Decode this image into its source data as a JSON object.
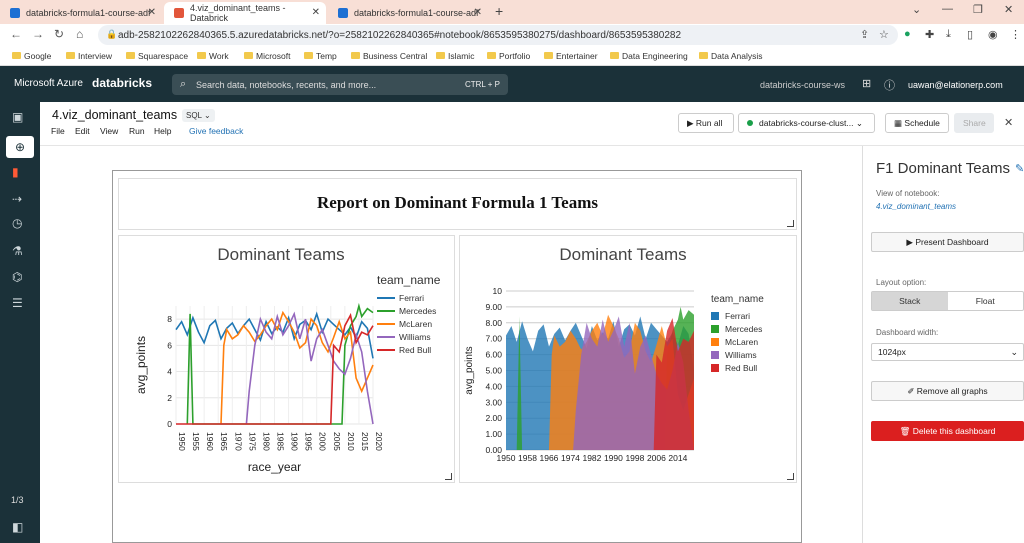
{
  "browser": {
    "tabs": [
      {
        "title": "databricks-formula1-course-adf",
        "favicon_color": "#1d6fd3"
      },
      {
        "title": "4.viz_dominant_teams - Databrick",
        "favicon_color": "#e2563b"
      },
      {
        "title": "databricks-formula1-course-adf",
        "favicon_color": "#1d6fd3"
      }
    ],
    "url": "adb-2582102262840365.5.azuredatabricks.net/?o=2582102262840365#notebook/8653595380275/dashboard/8653595380282",
    "bookmarks": [
      "Google",
      "Interview",
      "Squarespace",
      "Work",
      "Microsoft",
      "Temp",
      "Business Central",
      "Islamic",
      "Portfolio",
      "Entertainer",
      "Data Engineering",
      "Data Analysis"
    ]
  },
  "topbar": {
    "brand": "Microsoft Azure",
    "product": "databricks",
    "search_placeholder": "Search data, notebooks, recents, and more...",
    "search_shortcut": "CTRL + P",
    "workspace": "databricks-course-ws",
    "user": "uawan@elationerp.com"
  },
  "sidebar": {
    "page_indicator": "1/3"
  },
  "notebook": {
    "title": "4.viz_dominant_teams",
    "language": "SQL",
    "menu": [
      "File",
      "Edit",
      "View",
      "Run",
      "Help"
    ],
    "feedback": "Give feedback",
    "run_all": "Run all",
    "cluster": "databricks-course-clust...",
    "schedule": "Schedule",
    "share": "Share"
  },
  "dashboard": {
    "report_title": "Report on Dominant Formula 1 Teams",
    "colors": {
      "Ferrari": "#1f77b4",
      "Mercedes": "#2ca02c",
      "McLaren": "#ff7f0e",
      "Williams": "#9467bd",
      "Red Bull": "#d62728"
    }
  },
  "right_panel": {
    "title": "F1 Dominant Teams",
    "view_label": "View of notebook:",
    "notebook_link": "4.viz_dominant_teams",
    "present_button": "Present Dashboard",
    "layout_label": "Layout option:",
    "layout_stack": "Stack",
    "layout_float": "Float",
    "width_label": "Dashboard width:",
    "width_value": "1024px",
    "remove_button": "Remove all graphs",
    "delete_button": "Delete this dashboard"
  },
  "chart_data": [
    {
      "type": "line",
      "title": "Dominant Teams",
      "xlabel": "race_year",
      "ylabel": "avg_points",
      "legend_title": "team_name",
      "legend_position": "right",
      "xlim": [
        1950,
        2020
      ],
      "ylim": [
        0,
        9
      ],
      "x_ticks": [
        1950,
        1955,
        1960,
        1965,
        1970,
        1975,
        1980,
        1985,
        1990,
        1995,
        2000,
        2005,
        2010,
        2015,
        2020
      ],
      "y_ticks": [
        0,
        2,
        4,
        6,
        8
      ],
      "grid": true,
      "series": [
        {
          "name": "Ferrari",
          "x": [
            1950,
            1952,
            1954,
            1956,
            1958,
            1960,
            1962,
            1964,
            1966,
            1968,
            1970,
            1972,
            1974,
            1976,
            1978,
            1980,
            1982,
            1984,
            1986,
            1988,
            1990,
            1992,
            1994,
            1996,
            1998,
            2000,
            2002,
            2004,
            2006,
            2008,
            2010,
            2012,
            2014,
            2016,
            2018,
            2020
          ],
          "values": [
            7.2,
            7.8,
            6.8,
            8.1,
            7.0,
            6.2,
            7.5,
            7.9,
            6.5,
            7.3,
            7.7,
            6.9,
            7.5,
            8.0,
            7.2,
            6.4,
            7.8,
            6.9,
            7.4,
            7.0,
            8.1,
            6.5,
            7.6,
            7.9,
            7.2,
            8.4,
            7.0,
            8.0,
            7.6,
            7.2,
            6.8,
            7.4,
            6.6,
            7.8,
            7.3,
            5.0
          ]
        },
        {
          "name": "Mercedes",
          "x": [
            1954,
            1955,
            1956,
            2009,
            2010,
            2012,
            2014,
            2015,
            2016,
            2018,
            2020
          ],
          "values": [
            0,
            8.4,
            0,
            0,
            6.0,
            7.5,
            8.2,
            9.0,
            8.2,
            8.8,
            8.5
          ]
        },
        {
          "name": "McLaren",
          "x": [
            1966,
            1967,
            1968,
            1970,
            1972,
            1974,
            1976,
            1978,
            1980,
            1982,
            1984,
            1986,
            1988,
            1990,
            1992,
            1994,
            1996,
            1998,
            2000,
            2002,
            2004,
            2006,
            2008,
            2010,
            2012,
            2014,
            2016,
            2018,
            2020
          ],
          "values": [
            0,
            6.0,
            7.2,
            6.5,
            6.8,
            7.5,
            7.0,
            6.3,
            6.8,
            7.5,
            8.0,
            7.2,
            8.5,
            7.8,
            7.0,
            5.8,
            6.2,
            8.0,
            7.5,
            6.2,
            5.5,
            6.6,
            7.8,
            6.5,
            7.0,
            3.5,
            2.5,
            3.5,
            4.5
          ]
        },
        {
          "name": "Williams",
          "x": [
            1975,
            1976,
            1978,
            1980,
            1982,
            1984,
            1986,
            1988,
            1990,
            1992,
            1994,
            1996,
            1998,
            2000,
            2002,
            2004,
            2006,
            2008,
            2010,
            2012,
            2014,
            2016,
            2018,
            2020
          ],
          "values": [
            0,
            2.5,
            6.0,
            8.0,
            7.0,
            6.5,
            8.2,
            6.8,
            7.5,
            8.4,
            6.5,
            8.0,
            4.8,
            6.5,
            7.2,
            6.0,
            4.8,
            4.2,
            3.8,
            5.0,
            6.8,
            5.5,
            2.5,
            0
          ]
        },
        {
          "name": "Red Bull",
          "x": [
            1950,
            2005,
            2006,
            2008,
            2010,
            2012,
            2014,
            2016,
            2018,
            2020
          ],
          "values": [
            0,
            0,
            6.0,
            5.5,
            7.5,
            8.3,
            6.2,
            7.0,
            6.8,
            7.5
          ]
        }
      ]
    },
    {
      "type": "area",
      "title": "Dominant Teams",
      "xlabel": "",
      "ylabel": "avg_points",
      "legend_title": "team_name",
      "legend_position": "right",
      "xlim": [
        1950,
        2020
      ],
      "ylim": [
        0,
        10
      ],
      "x_ticks": [
        1950,
        1958,
        1966,
        1974,
        1982,
        1990,
        1998,
        2006,
        2014
      ],
      "y_ticks": [
        "0.00",
        "1.00",
        "2.00",
        "3.00",
        "4.00",
        "5.00",
        "6.00",
        "7.00",
        "8.00",
        "9.00",
        "10"
      ],
      "grid": true,
      "series": [
        {
          "name": "Ferrari",
          "x": [
            1950,
            1952,
            1954,
            1956,
            1958,
            1960,
            1962,
            1964,
            1966,
            1968,
            1970,
            1972,
            1974,
            1976,
            1978,
            1980,
            1982,
            1984,
            1986,
            1988,
            1990,
            1992,
            1994,
            1996,
            1998,
            2000,
            2002,
            2004,
            2006,
            2008,
            2010,
            2012,
            2014,
            2016,
            2018,
            2020
          ],
          "values": [
            7.2,
            7.8,
            6.8,
            8.1,
            7.0,
            6.2,
            7.5,
            7.9,
            6.5,
            7.3,
            7.7,
            6.9,
            7.5,
            8.0,
            7.2,
            6.4,
            7.8,
            6.9,
            7.4,
            7.0,
            8.1,
            6.5,
            7.6,
            7.9,
            7.2,
            8.4,
            7.0,
            8.0,
            7.6,
            7.2,
            6.8,
            7.4,
            6.6,
            7.8,
            7.3,
            5.0
          ]
        },
        {
          "name": "Mercedes",
          "x": [
            1954,
            1955,
            1956,
            2009,
            2010,
            2012,
            2014,
            2015,
            2016,
            2018,
            2020
          ],
          "values": [
            0,
            8.4,
            0,
            0,
            6.0,
            7.5,
            8.2,
            9.0,
            8.2,
            8.8,
            8.5
          ]
        },
        {
          "name": "McLaren",
          "x": [
            1966,
            1967,
            1968,
            1970,
            1972,
            1974,
            1976,
            1978,
            1980,
            1982,
            1984,
            1986,
            1988,
            1990,
            1992,
            1994,
            1996,
            1998,
            2000,
            2002,
            2004,
            2006,
            2008,
            2010,
            2012,
            2014,
            2016,
            2018,
            2020
          ],
          "values": [
            0,
            6.0,
            7.2,
            6.5,
            6.8,
            7.5,
            7.0,
            6.3,
            6.8,
            7.5,
            8.0,
            7.2,
            8.5,
            7.8,
            7.0,
            5.8,
            6.2,
            8.0,
            7.5,
            6.2,
            5.5,
            6.6,
            7.8,
            6.5,
            7.0,
            3.5,
            2.5,
            3.5,
            4.5
          ]
        },
        {
          "name": "Williams",
          "x": [
            1975,
            1976,
            1978,
            1980,
            1982,
            1984,
            1986,
            1988,
            1990,
            1992,
            1994,
            1996,
            1998,
            2000,
            2002,
            2004,
            2006,
            2008,
            2010,
            2012,
            2014,
            2016,
            2018,
            2020
          ],
          "values": [
            0,
            2.5,
            6.0,
            8.0,
            7.0,
            6.5,
            8.2,
            6.8,
            7.5,
            8.4,
            6.5,
            8.0,
            4.8,
            6.5,
            7.2,
            6.0,
            4.8,
            4.2,
            3.8,
            5.0,
            6.8,
            5.5,
            2.5,
            0
          ]
        },
        {
          "name": "Red Bull",
          "x": [
            1950,
            2005,
            2006,
            2008,
            2010,
            2012,
            2014,
            2016,
            2018,
            2020
          ],
          "values": [
            0,
            0,
            6.0,
            5.5,
            7.5,
            8.3,
            6.2,
            7.0,
            6.8,
            7.5
          ]
        }
      ]
    }
  ]
}
